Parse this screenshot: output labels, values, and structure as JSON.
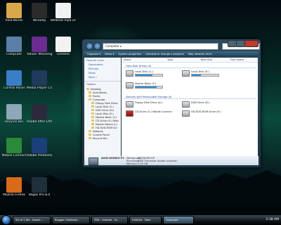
{
  "desktop": {
    "icons": [
      {
        "label": "Axid-Works",
        "color": "#d9a84a"
      },
      {
        "label": "Winamp",
        "color": "#2b2b2b"
      },
      {
        "label": "lbttbhat.mp4.url",
        "color": "#f2f2f2"
      },
      {
        "label": "Computer",
        "color": "#5a7fa8"
      },
      {
        "label": "Yahoo! Messenger",
        "color": "#6a2c8f"
      },
      {
        "label": "Untitled",
        "color": "#f2f2f2"
      },
      {
        "label": "Control Panel",
        "color": "#3a7ec8"
      },
      {
        "label": "Media Player Classic",
        "color": "#1f3a5a"
      },
      {
        "label": "Recycle Bin",
        "color": "#8fa7b8"
      },
      {
        "label": "Adobe After Effects CS",
        "color": "#2a2a3a"
      },
      {
        "label": "Mobile Connect",
        "color": "#2a8a3a"
      },
      {
        "label": "Adobe Photoshop CS",
        "color": "#1a3f7a"
      },
      {
        "label": "Mozilla Firefox",
        "color": "#d86a1a"
      },
      {
        "label": "Vegas Pro 8.0",
        "color": "#20303a"
      }
    ]
  },
  "window": {
    "address": "Computer ▸",
    "toolbar": [
      "Organize ▾",
      "Views ▾",
      "System properties",
      "Uninstall or change a program",
      "Map network drive"
    ],
    "nav": {
      "favorites_header": "Favorite Links",
      "favorites": [
        "Documents",
        "Pictures",
        "Music",
        "More »"
      ],
      "folders_header": "Folders",
      "tree": [
        "Desktop",
        "Axid-Works",
        "Public",
        "Computer",
        "Floppy Disk Drive",
        "Local Disk (C:)",
        "DVD Drive (D:)",
        "Local Disk (E:)",
        "Maxtor Basic (F:)",
        "CD Drive (G:) Mob",
        "Master Basics (I:)",
        "HD DVD-ROM Dri",
        "Network",
        "Control Panel",
        "Recycle Bin"
      ]
    },
    "columns": [
      "Name",
      "Type",
      "Total Size",
      "Free Space"
    ],
    "hard_disk_header": "Hard Disk Drives (3)",
    "hard_disks": [
      {
        "name": "Local Disk (C:)",
        "sub": "",
        "used": 0.62
      },
      {
        "name": "Local Disk (E:)",
        "sub": "",
        "used": 0.35
      },
      {
        "name": "Maxtor Basic (F:)",
        "sub": "",
        "used": 0.8
      }
    ],
    "removable_header": "Devices with Removable Storage (4)",
    "removable": [
      {
        "name": "Floppy Disk Drive (A:)"
      },
      {
        "name": "DVD Drive (D:)"
      },
      {
        "name": "CD Drive (G:) Mobile Connect"
      },
      {
        "name": "HD DVD-ROM Drive (H:)"
      }
    ],
    "details": {
      "name": "AXID-WORKS-PC",
      "workgroup_label": "Workgroup:",
      "workgroup": "WORKGROUP",
      "processor_label": "Processor:",
      "processor": "AMD Processor model unknown",
      "memory_label": "Memory:",
      "memory": "2.00 GB"
    }
  },
  "taskbar": {
    "buttons": [
      "4% of 1 file - Downl...",
      "Blogger: Rahbotiz...",
      "ZEN - Untitled - Sc...",
      "Untitled - Paint",
      "Computer"
    ],
    "clock": "2:38 AM"
  }
}
